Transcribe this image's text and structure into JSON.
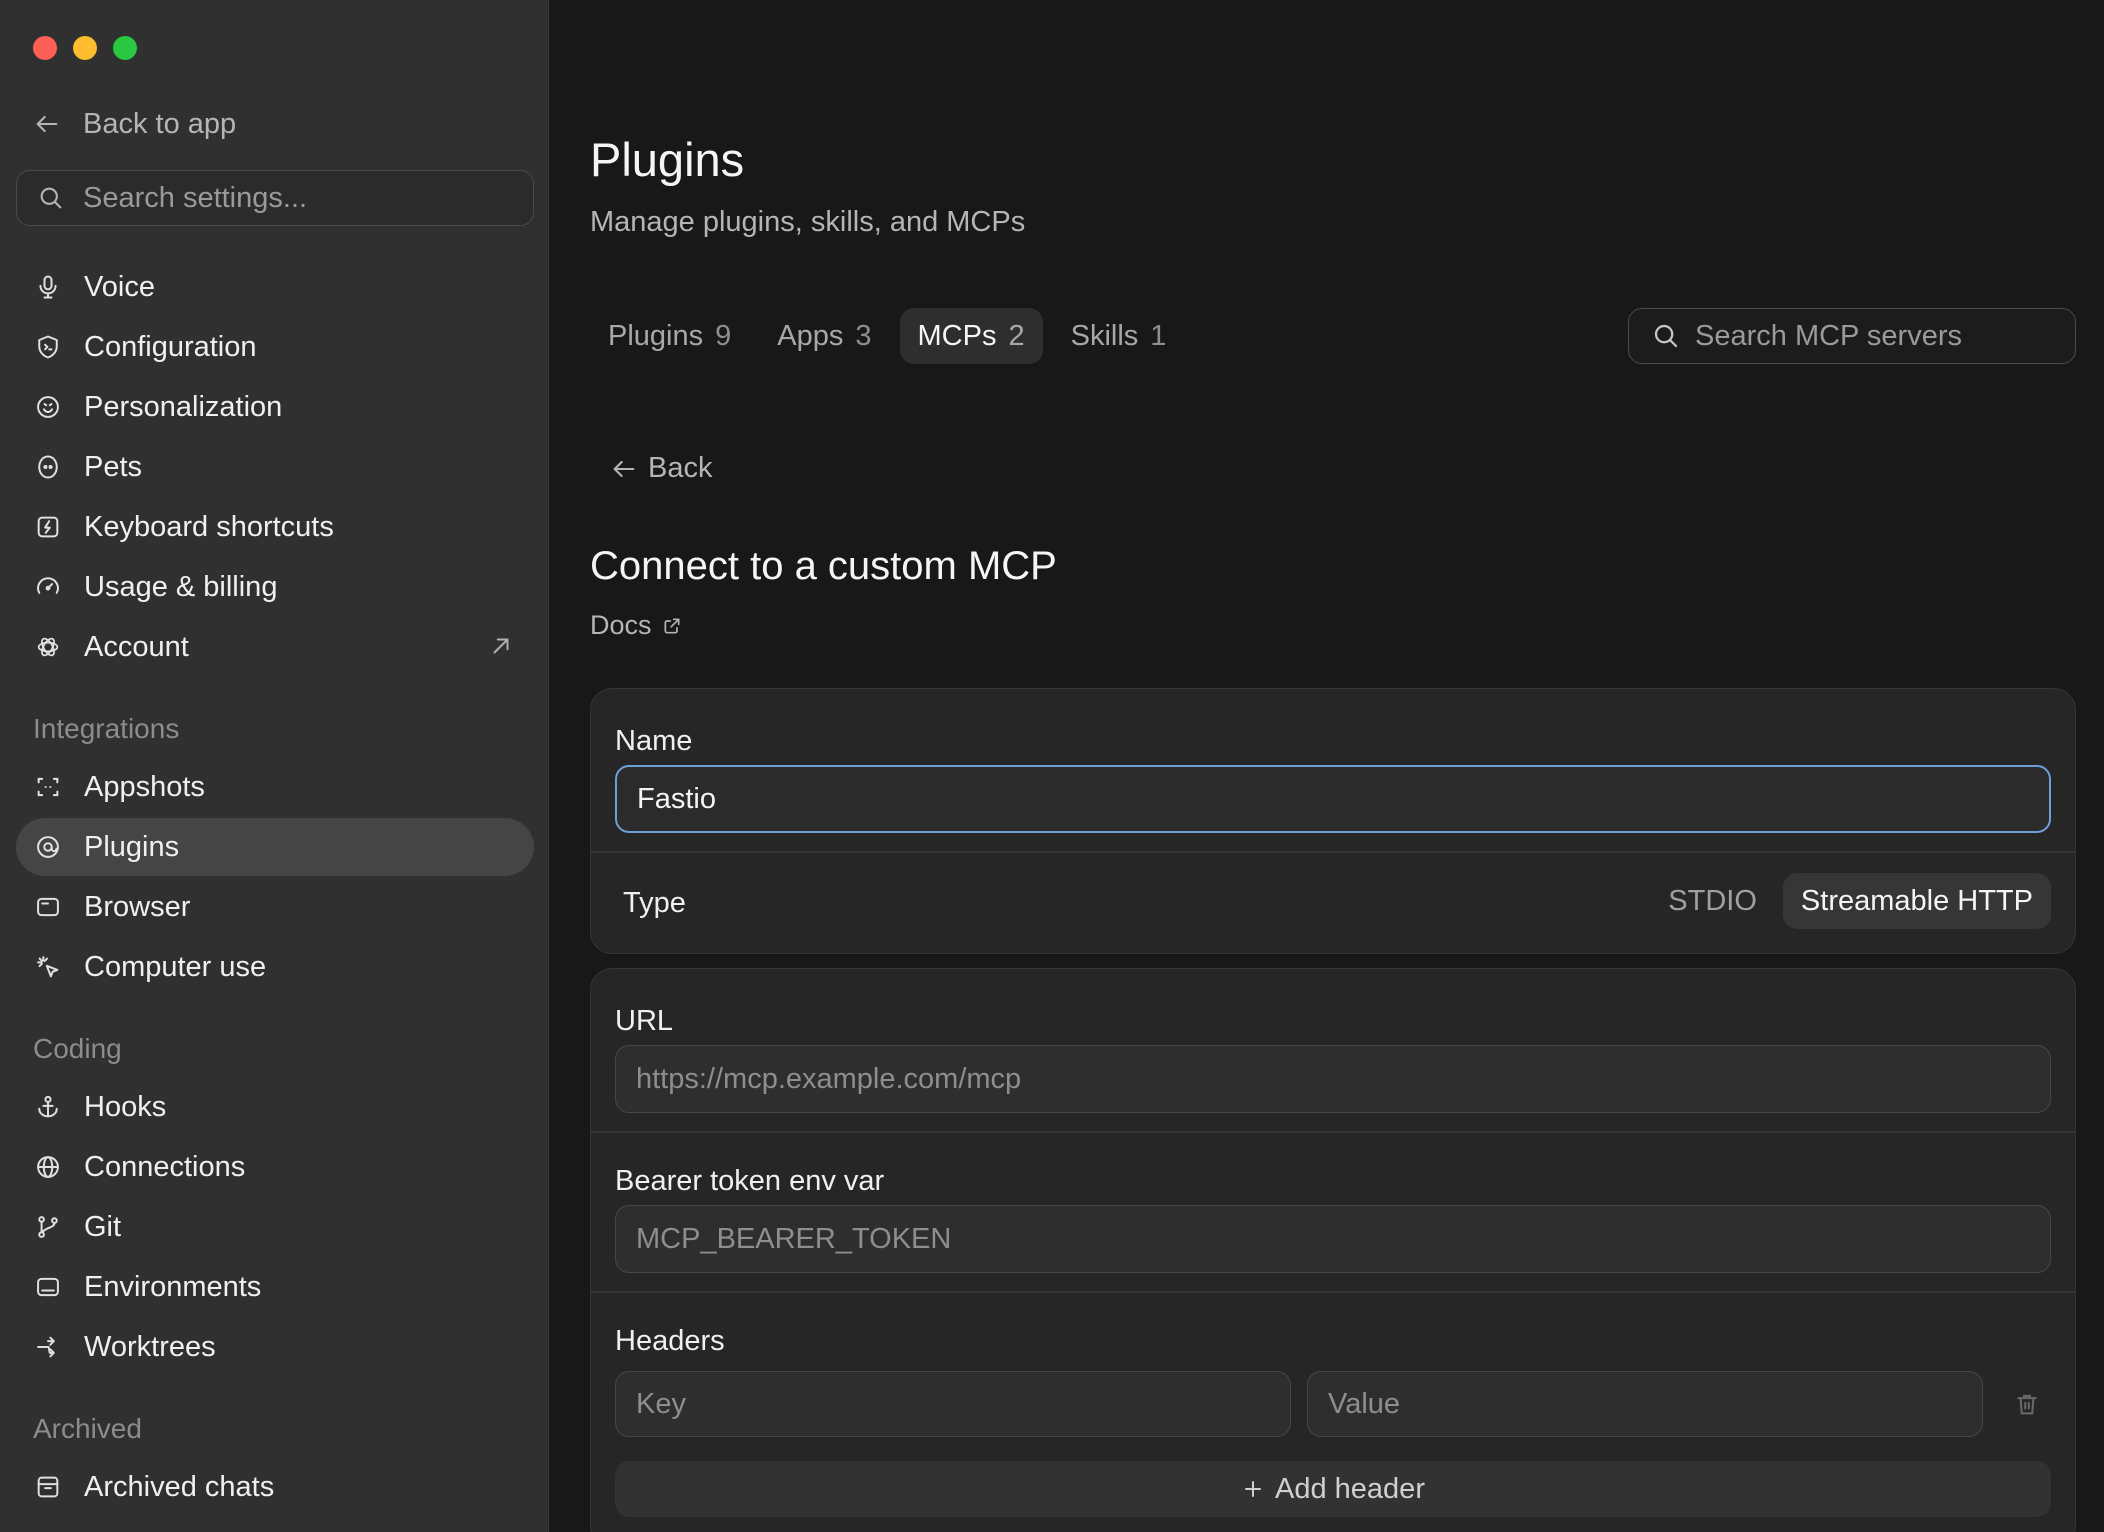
{
  "sidebar": {
    "back_label": "Back to app",
    "search_placeholder": "Search settings...",
    "items": [
      {
        "label": "Voice",
        "icon": "microphone-icon"
      },
      {
        "label": "Configuration",
        "icon": "shield-icon"
      },
      {
        "label": "Personalization",
        "icon": "smiley-icon"
      },
      {
        "label": "Pets",
        "icon": "pet-icon"
      },
      {
        "label": "Keyboard shortcuts",
        "icon": "keyboard-bolt-icon"
      },
      {
        "label": "Usage & billing",
        "icon": "gauge-icon"
      },
      {
        "label": "Account",
        "icon": "openai-logo-icon"
      }
    ],
    "integrations_label": "Integrations",
    "integrations": [
      {
        "label": "Appshots",
        "icon": "screenshot-icon"
      },
      {
        "label": "Plugins",
        "icon": "plugin-icon",
        "active": true
      },
      {
        "label": "Browser",
        "icon": "browser-icon"
      },
      {
        "label": "Computer use",
        "icon": "cursor-click-icon"
      }
    ],
    "coding_label": "Coding",
    "coding": [
      {
        "label": "Hooks",
        "icon": "anchor-icon"
      },
      {
        "label": "Connections",
        "icon": "globe-icon"
      },
      {
        "label": "Git",
        "icon": "git-branch-icon"
      },
      {
        "label": "Environments",
        "icon": "terminal-window-icon"
      },
      {
        "label": "Worktrees",
        "icon": "worktree-icon"
      }
    ],
    "archived_label": "Archived",
    "archived": [
      {
        "label": "Archived chats",
        "icon": "archive-icon"
      }
    ]
  },
  "main": {
    "title": "Plugins",
    "subtitle": "Manage plugins, skills, and MCPs",
    "tabs": [
      {
        "label": "Plugins",
        "count": "9"
      },
      {
        "label": "Apps",
        "count": "3"
      },
      {
        "label": "MCPs",
        "count": "2",
        "active": true
      },
      {
        "label": "Skills",
        "count": "1"
      }
    ],
    "search_placeholder": "Search MCP servers",
    "back_label": "Back",
    "connect_title": "Connect to a custom MCP",
    "docs_label": "Docs",
    "name_label": "Name",
    "name_value": "Fastio",
    "type_label": "Type",
    "type_options": [
      "STDIO",
      "Streamable HTTP"
    ],
    "type_selected": "Streamable HTTP",
    "url_label": "URL",
    "url_placeholder": "https://mcp.example.com/mcp",
    "bearer_label": "Bearer token env var",
    "bearer_placeholder": "MCP_BEARER_TOKEN",
    "headers_label": "Headers",
    "key_placeholder": "Key",
    "value_placeholder": "Value",
    "add_header_label": "Add header"
  }
}
